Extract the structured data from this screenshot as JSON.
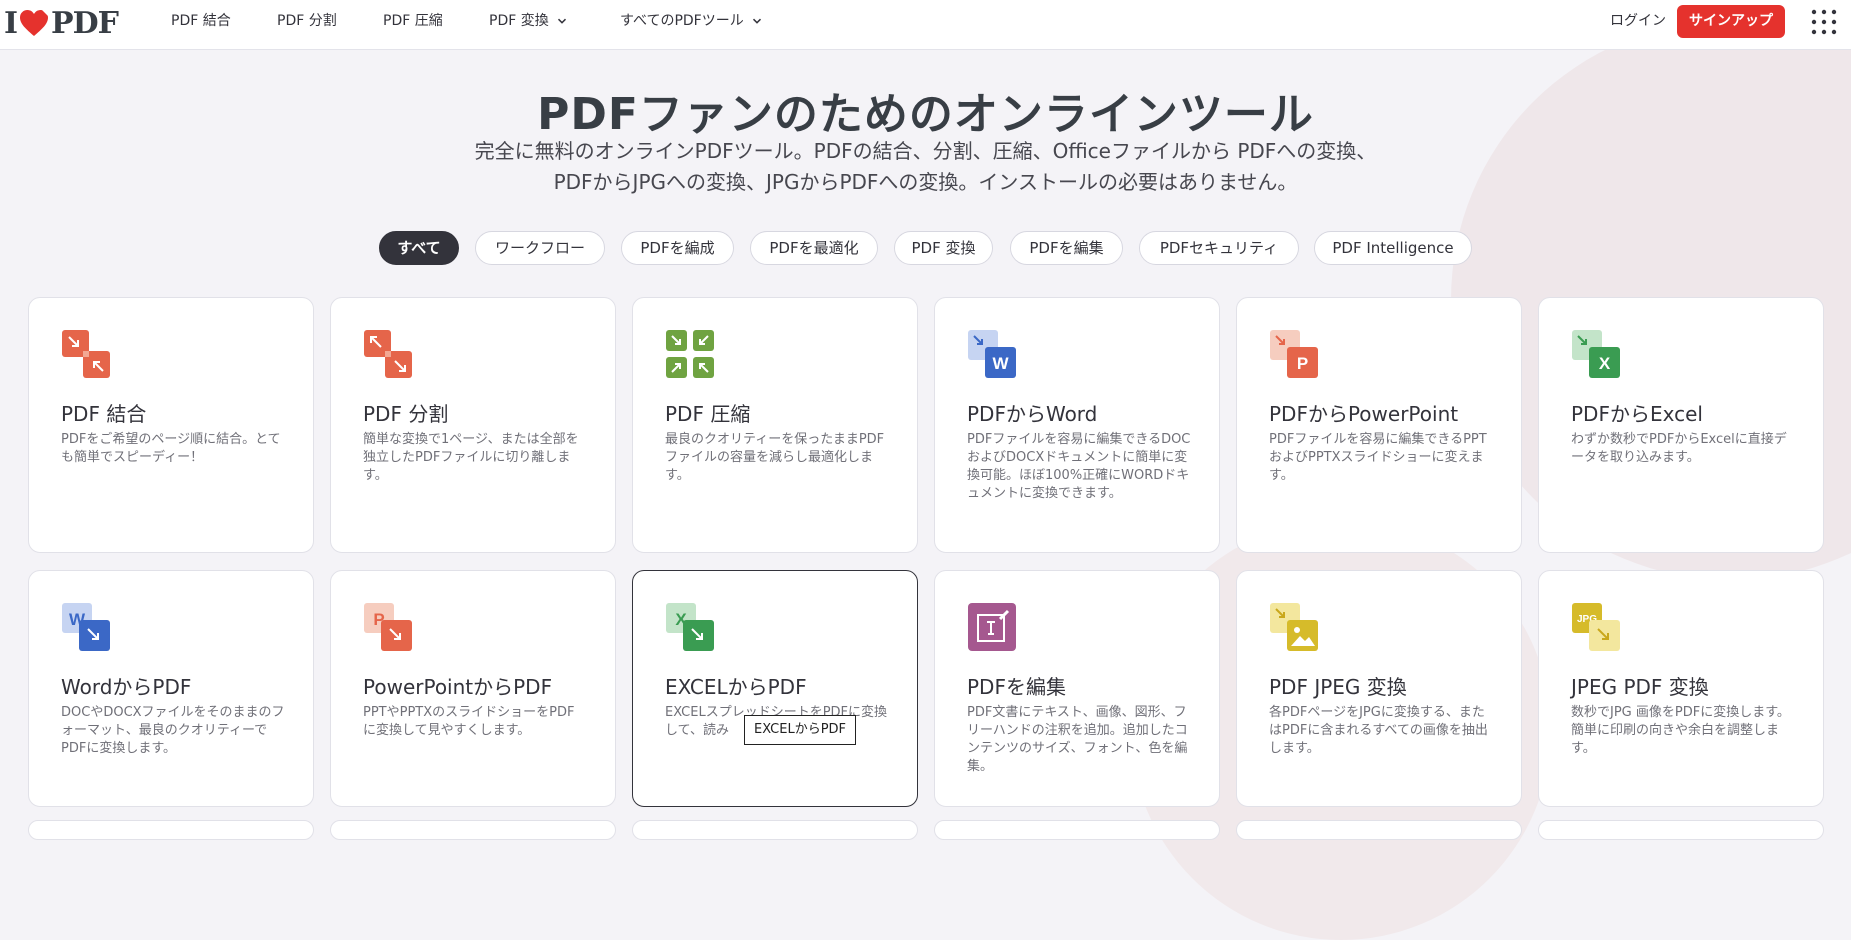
{
  "header": {
    "logo_i": "I",
    "logo_pdf": "PDF",
    "nav": [
      {
        "label": "PDF 結合"
      },
      {
        "label": "PDF 分割"
      },
      {
        "label": "PDF 圧縮"
      },
      {
        "label": "PDF 変換"
      },
      {
        "label": "すべてのPDFツール"
      }
    ],
    "login": "ログイン",
    "signup": "サインアップ"
  },
  "hero": {
    "title": "PDFファンのためのオンラインツール",
    "subtitle_line1": "完全に無料のオンラインPDFツール。PDFの結合、分割、圧縮、Officeファイルから PDFへの変換、",
    "subtitle_line2": "PDFからJPGへの変換、JPGからPDFへの変換。インストールの必要はありません。"
  },
  "filters": [
    {
      "label": "すべて"
    },
    {
      "label": "ワークフロー"
    },
    {
      "label": "PDFを編成"
    },
    {
      "label": "PDFを最適化"
    },
    {
      "label": "PDF 変換"
    },
    {
      "label": "PDFを編集"
    },
    {
      "label": "PDFセキュリティ"
    },
    {
      "label": "PDF Intelligence"
    }
  ],
  "tools": [
    {
      "title": "PDF 結合",
      "desc": "PDFをご希望のページ順に結合。とても簡単でスピーディー！"
    },
    {
      "title": "PDF 分割",
      "desc": "簡単な変換で1ページ、または全部を独立したPDFファイルに切り離します。"
    },
    {
      "title": "PDF 圧縮",
      "desc": "最良のクオリティーを保ったままPDFファイルの容量を減らし最適化します。"
    },
    {
      "title": "PDFからWord",
      "desc": "PDFファイルを容易に編集できるDOCおよびDOCXドキュメントに簡単に変換可能。ほぼ100%正確にWORDドキュメントに変換できます。"
    },
    {
      "title": "PDFからPowerPoint",
      "desc": "PDFファイルを容易に編集できるPPTおよびPPTXスライドショーに変えます。"
    },
    {
      "title": "PDFからExcel",
      "desc": "わずか数秒でPDFからExcelに直接データを取り込みます。"
    },
    {
      "title": "WordからPDF",
      "desc": "DOCやDOCXファイルをそのままのフォーマット、最良のクオリティーでPDFに変換します。"
    },
    {
      "title": "PowerPointからPDF",
      "desc": "PPTやPPTXのスライドショーをPDFに変換して見やすくします。"
    },
    {
      "title": "EXCELからPDF",
      "desc": "EXCELスプレッドシートをPDFに変換して、読み"
    },
    {
      "title": "PDFを編集",
      "desc": "PDF文書にテキスト、画像、図形、フリーハンドの注釈を追加。追加したコンテンツのサイズ、フォント、色を編集。"
    },
    {
      "title": "PDF JPEG 変換",
      "desc": "各PDFページをJPGに変換する、またはPDFに含まれるすべての画像を抽出します。"
    },
    {
      "title": "JPEG PDF 変換",
      "desc": "数秒でJPG 画像をPDFに変換します。簡単に印刷の向きや余白を調整します。"
    }
  ],
  "icons": {
    "jpg_badge": "JPG",
    "word_letter": "W",
    "ppt_letter": "P",
    "excel_letter": "X"
  },
  "tooltip": "EXCELからPDF",
  "colors": {
    "brand_red": "#e5322d",
    "merge_orange": "#e5654a",
    "compress_green": "#6fa341",
    "word_blue": "#3b68c6",
    "ppt_orange": "#e5654a",
    "excel_green": "#3a9c52",
    "edit_purple": "#a5588f",
    "jpg_yellow": "#d6bb2a"
  }
}
